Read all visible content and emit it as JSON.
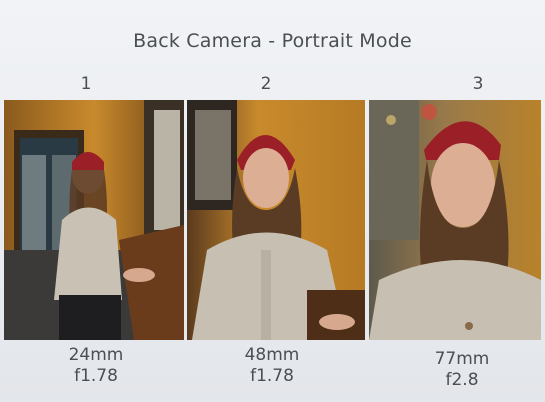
{
  "title": "Back Camera - Portrait Mode",
  "photos": [
    {
      "number": "1",
      "focal": "24mm",
      "aperture": "f1.78"
    },
    {
      "number": "2",
      "focal": "48mm",
      "aperture": "f1.78"
    },
    {
      "number": "3",
      "focal": "77mm",
      "aperture": "f2.8"
    }
  ]
}
